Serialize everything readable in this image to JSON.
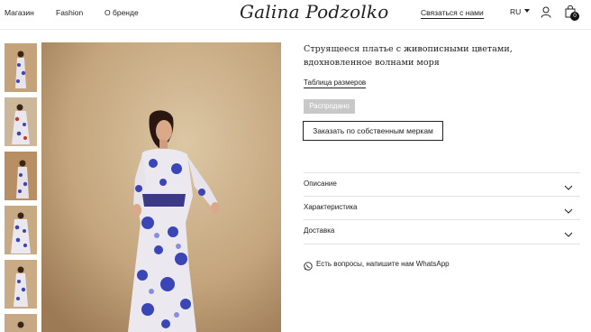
{
  "header": {
    "nav": [
      "Магазин",
      "Fashion",
      "О бренде"
    ],
    "logo": "Galina Podzolko",
    "contact": "Связаться с нами",
    "lang": "RU",
    "cart_count": "0"
  },
  "product": {
    "title": "Струящееся платье с живописными цветами, вдохновленное волнами моря",
    "size_table": "Таблица размеров",
    "sold_out": "Распродано",
    "custom_button": "Заказать по собственным меркам"
  },
  "accordion": [
    {
      "label": "Описание"
    },
    {
      "label": "Характеристика"
    },
    {
      "label": "Доставка"
    }
  ],
  "whatsapp": {
    "text": "Есть вопросы, напишите нам WhatsApp",
    "icon": "whatsapp-icon"
  },
  "colors": {
    "sold_out_bg": "#c8c8c8",
    "photo_bg": "#c9b08c",
    "dress_blue": "#3a46b8"
  }
}
